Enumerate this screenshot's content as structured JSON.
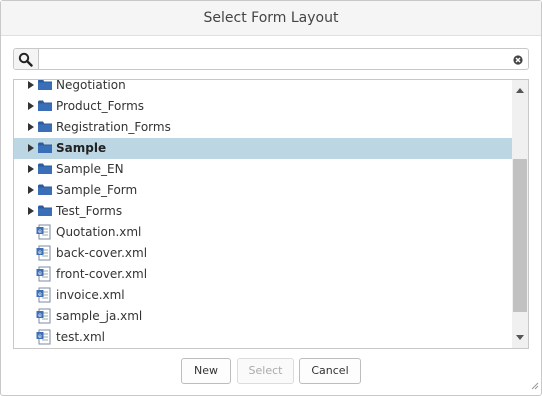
{
  "dialog": {
    "title": "Select Form Layout"
  },
  "search": {
    "value": "",
    "placeholder": ""
  },
  "tree": {
    "items": [
      {
        "label": "Negotiation",
        "type": "folder"
      },
      {
        "label": "Product_Forms",
        "type": "folder"
      },
      {
        "label": "Registration_Forms",
        "type": "folder"
      },
      {
        "label": "Sample",
        "type": "folder",
        "selected": true
      },
      {
        "label": "Sample_EN",
        "type": "folder"
      },
      {
        "label": "Sample_Form",
        "type": "folder"
      },
      {
        "label": "Test_Forms",
        "type": "folder"
      },
      {
        "label": "Quotation.xml",
        "type": "file"
      },
      {
        "label": "back-cover.xml",
        "type": "file"
      },
      {
        "label": "front-cover.xml",
        "type": "file"
      },
      {
        "label": "invoice.xml",
        "type": "file"
      },
      {
        "label": "sample_ja.xml",
        "type": "file"
      },
      {
        "label": "test.xml",
        "type": "file"
      }
    ]
  },
  "buttons": {
    "new": "New",
    "select": "Select",
    "cancel": "Cancel"
  },
  "colors": {
    "selection": "#bcd7e3",
    "folder": "#2b5c9e",
    "file": "#3f6fb5"
  }
}
